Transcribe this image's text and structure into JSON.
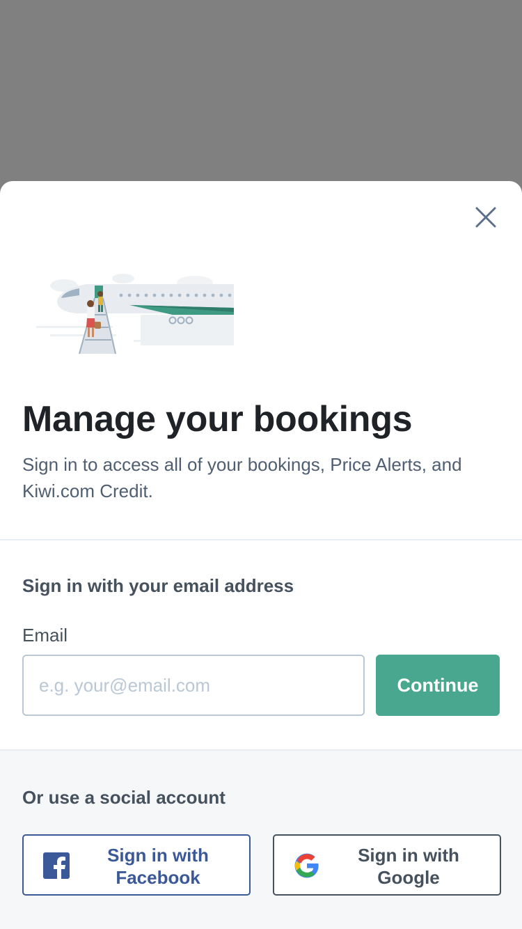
{
  "modal": {
    "title": "Manage your bookings",
    "subtitle": "Sign in to access all of your bookings, Price Alerts, and Kiwi.com Credit.",
    "close_icon": "close-icon",
    "illustration": "airplane-boarding-illustration"
  },
  "email_section": {
    "heading": "Sign in with your email address",
    "label": "Email",
    "placeholder": "e.g. your@email.com",
    "value": "",
    "continue_label": "Continue"
  },
  "social_section": {
    "heading": "Or use a social account",
    "facebook_label": "Sign in with Facebook",
    "google_label": "Sign in with Google",
    "facebook_icon": "facebook-icon",
    "google_icon": "google-icon"
  },
  "colors": {
    "accent": "#4aa78f",
    "facebook": "#3b5998",
    "text_dark": "#1f2227",
    "text_muted": "#46515e",
    "backdrop": "#808080"
  }
}
